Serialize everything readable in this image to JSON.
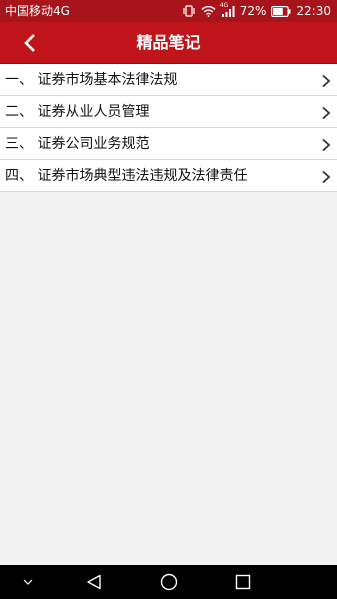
{
  "status_bar": {
    "carrier": "中国移动4G",
    "network_badge": "4G",
    "battery_percent": "72%",
    "battery_level": 0.72,
    "time": "22:30",
    "icons": [
      "vibrate-icon",
      "wifi-icon",
      "signal-icon",
      "battery-icon"
    ]
  },
  "header": {
    "title": "精品笔记",
    "back_icon": "chevron-left-icon"
  },
  "list": {
    "items": [
      {
        "label": "一、 证券市场基本法律法规"
      },
      {
        "label": "二、 证券从业人员管理"
      },
      {
        "label": "三、 证券公司业务规范"
      },
      {
        "label": "四、 证券市场典型违法违规及法律责任"
      }
    ],
    "item_icon": "chevron-right-icon"
  },
  "nav_bar": {
    "buttons": [
      "collapse-icon",
      "back-triangle-icon",
      "home-circle-icon",
      "recents-square-icon"
    ]
  },
  "colors": {
    "status_bar": "#a8141c",
    "title_bar": "#c0141b",
    "background": "#f2f2f2",
    "list_background": "#ffffff",
    "divider": "#d6d6d6",
    "text": "#111111",
    "nav_bar": "#000000"
  }
}
